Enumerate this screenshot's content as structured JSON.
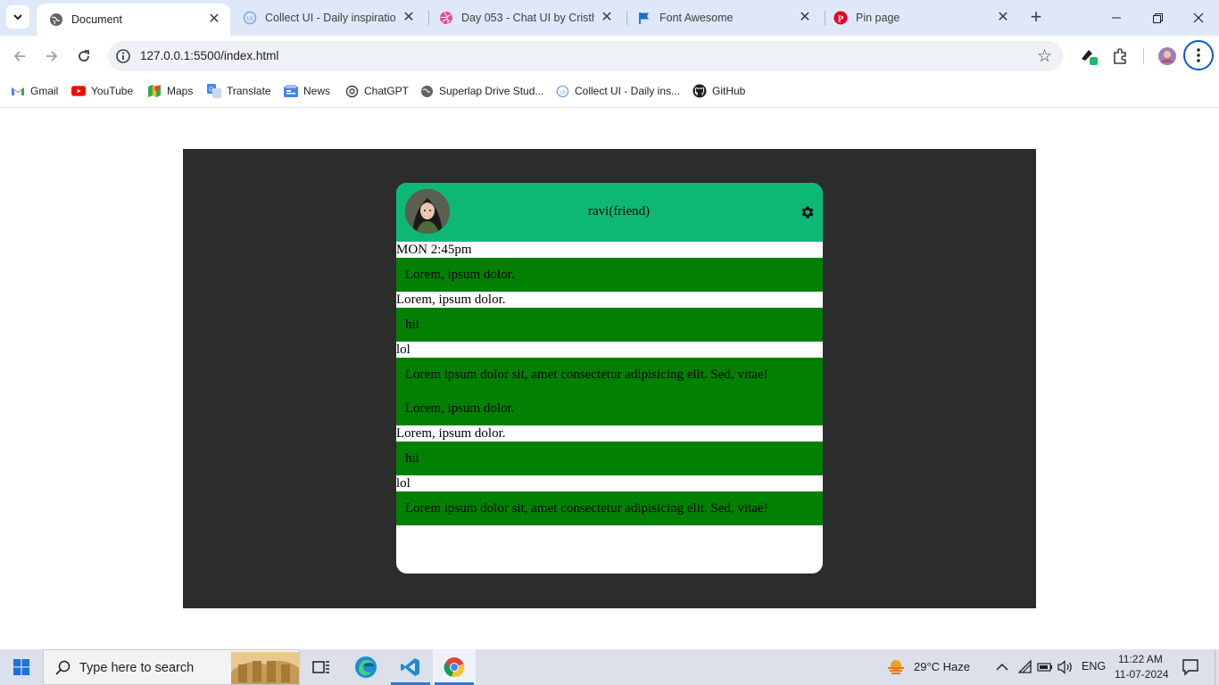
{
  "browser": {
    "tabs": [
      {
        "title": "Document",
        "icon": "globe-icon",
        "active": true
      },
      {
        "title": "Collect UI - Daily inspiration",
        "icon": "collectui-icon",
        "active": false
      },
      {
        "title": "Day 053 - Chat UI by Cristho",
        "icon": "dribbble-icon",
        "active": false
      },
      {
        "title": "Font Awesome",
        "icon": "flag-icon",
        "active": false
      },
      {
        "title": "Pin page",
        "icon": "pinterest-icon",
        "active": false
      }
    ],
    "url": "127.0.0.1:5500/index.html",
    "bookmarks": [
      {
        "label": "Gmail",
        "icon": "gmail-icon"
      },
      {
        "label": "YouTube",
        "icon": "youtube-icon"
      },
      {
        "label": "Maps",
        "icon": "maps-icon"
      },
      {
        "label": "Translate",
        "icon": "translate-icon"
      },
      {
        "label": "News",
        "icon": "news-icon"
      },
      {
        "label": "ChatGPT",
        "icon": "chatgpt-icon"
      },
      {
        "label": "Superlap Drive Stud...",
        "icon": "globe-icon"
      },
      {
        "label": "Collect UI - Daily ins...",
        "icon": "collectui-icon"
      },
      {
        "label": "GitHub",
        "icon": "github-icon"
      }
    ]
  },
  "chat": {
    "header": {
      "name": "ravi(friend)"
    },
    "messages": [
      {
        "text": "MON 2:45pm",
        "style": "plain"
      },
      {
        "text": "Lorem, ipsum dolor.",
        "style": "green"
      },
      {
        "text": "Lorem, ipsum dolor.",
        "style": "plain"
      },
      {
        "text": "hii",
        "style": "green"
      },
      {
        "text": "lol",
        "style": "plain"
      },
      {
        "text": "Lorem ipsum dolor sit, amet consectetur adipisicing elit. Sed, vitae!",
        "style": "green"
      },
      {
        "text": "Lorem, ipsum dolor.",
        "style": "green"
      },
      {
        "text": "Lorem, ipsum dolor.",
        "style": "plain"
      },
      {
        "text": "hii",
        "style": "green"
      },
      {
        "text": "lol",
        "style": "plain"
      },
      {
        "text": "Lorem ipsum dolor sit, amet consectetur adipisicing elit. Sed, vitae!",
        "style": "green"
      }
    ]
  },
  "taskbar": {
    "search_placeholder": "Type here to search",
    "weather": "29°C  Haze",
    "language": "ENG",
    "time": "11:22 AM",
    "date": "11-07-2024"
  },
  "colors": {
    "header_green": "#0db877",
    "message_green": "#018001",
    "stage_bg": "#2c2c2c",
    "accent_blue": "#0b57d0"
  }
}
